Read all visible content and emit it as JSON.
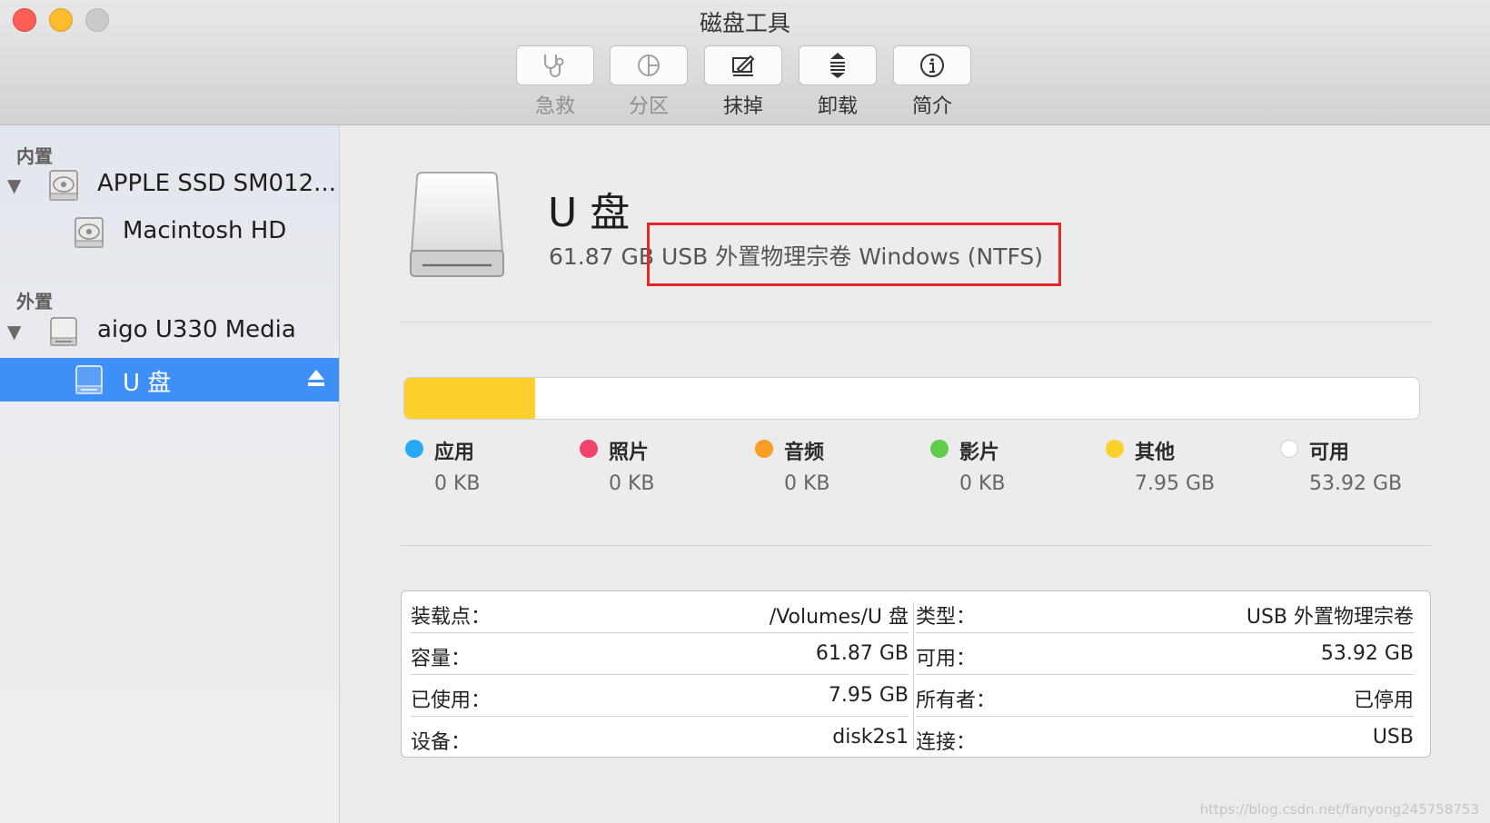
{
  "window": {
    "title": "磁盘工具"
  },
  "toolbar": {
    "buttons": [
      {
        "label": "急救",
        "icon": "stethoscope-icon",
        "enabled": false
      },
      {
        "label": "分区",
        "icon": "pie-icon",
        "enabled": false
      },
      {
        "label": "抹掉",
        "icon": "erase-icon",
        "enabled": true
      },
      {
        "label": "卸载",
        "icon": "unmount-icon",
        "enabled": true
      },
      {
        "label": "简介",
        "icon": "info-icon",
        "enabled": true
      }
    ]
  },
  "sidebar": {
    "internal_header": "内置",
    "external_header": "外置",
    "items": [
      {
        "label": "APPLE SSD SM012...",
        "icon": "internal-disk-icon"
      },
      {
        "label": "Macintosh HD",
        "icon": "internal-volume-icon"
      },
      {
        "label": "aigo U330 Media",
        "icon": "external-disk-icon"
      },
      {
        "label": "U 盘",
        "icon": "external-volume-icon",
        "selected": true
      }
    ]
  },
  "volume": {
    "name": "U 盘",
    "description": "61.87 GB USB 外置物理宗卷 Windows (NTFS)"
  },
  "usage": {
    "legend": [
      {
        "name": "应用",
        "size": "0 KB",
        "color": "#27aaf2"
      },
      {
        "name": "照片",
        "size": "0 KB",
        "color": "#f2436e"
      },
      {
        "name": "音频",
        "size": "0 KB",
        "color": "#fa9d27"
      },
      {
        "name": "影片",
        "size": "0 KB",
        "color": "#5fcd4b"
      },
      {
        "name": "其他",
        "size": "7.95 GB",
        "color": "#fdd02e"
      },
      {
        "name": "可用",
        "size": "53.92 GB",
        "color": "#ffffff"
      }
    ],
    "segments": [
      {
        "name": "其他",
        "fraction": 0.1285,
        "color": "#fdd02e"
      }
    ]
  },
  "info": {
    "left": [
      {
        "label": "装载点：",
        "value": "/Volumes/U 盘"
      },
      {
        "label": "容量：",
        "value": "61.87 GB"
      },
      {
        "label": "已使用：",
        "value": "7.95 GB"
      },
      {
        "label": "设备：",
        "value": "disk2s1"
      }
    ],
    "right": [
      {
        "label": "类型：",
        "value": "USB 外置物理宗卷"
      },
      {
        "label": "可用：",
        "value": "53.92 GB"
      },
      {
        "label": "所有者：",
        "value": "已停用"
      },
      {
        "label": "连接：",
        "value": "USB"
      }
    ]
  },
  "watermark": "https://blog.csdn.net/fanyong245758753"
}
